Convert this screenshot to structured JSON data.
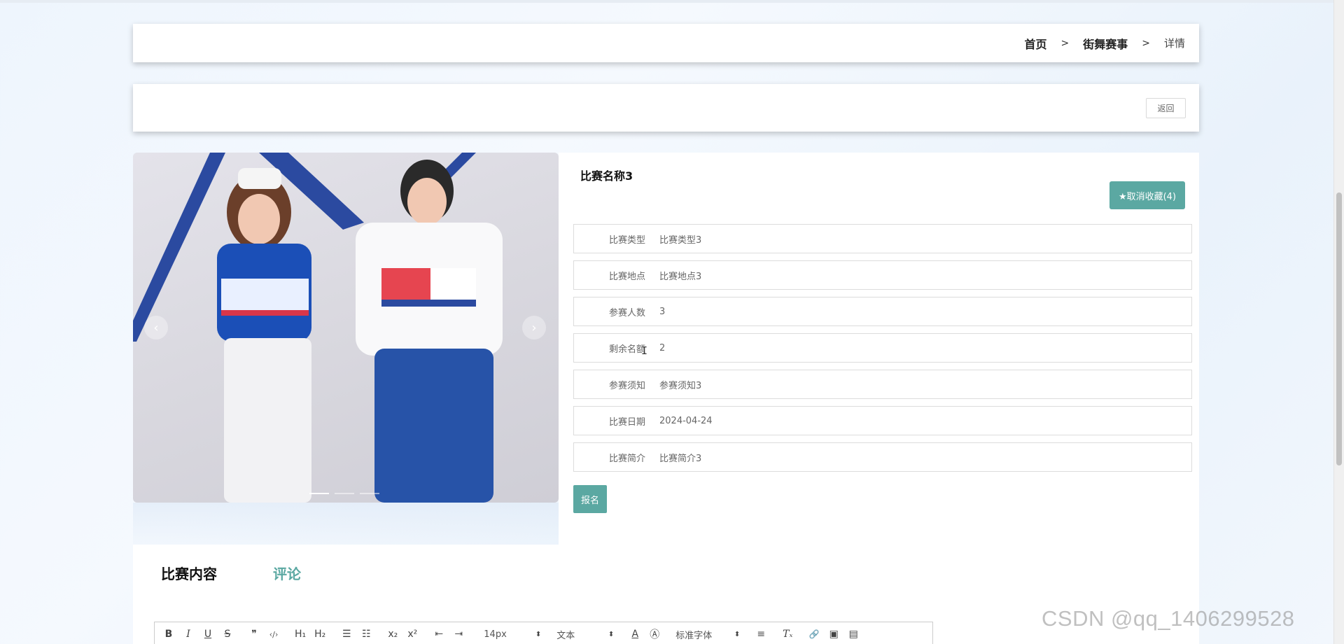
{
  "breadcrumb": {
    "home": "首页",
    "sep1": ">",
    "section": "街舞赛事",
    "sep2": ">",
    "current": "详情"
  },
  "back_button": "返回",
  "carousel": {
    "prev": "‹",
    "next": "›",
    "slide_count": 3,
    "active_slide": 1
  },
  "detail": {
    "title": "比赛名称3",
    "favorite_button": "★取消收藏(4)",
    "fields": [
      {
        "label": "比赛类型",
        "value": "比赛类型3"
      },
      {
        "label": "比赛地点",
        "value": "比赛地点3"
      },
      {
        "label": "参赛人数",
        "value": "3"
      },
      {
        "label": "剩余名额",
        "value": "2"
      },
      {
        "label": "参赛须知",
        "value": "参赛须知3"
      },
      {
        "label": "比赛日期",
        "value": "2024-04-24"
      },
      {
        "label": "比赛简介",
        "value": "比赛简介3"
      }
    ],
    "signup_button": "报名"
  },
  "tabs": {
    "content": "比赛内容",
    "comment": "评论"
  },
  "editor_toolbar": {
    "bold": "B",
    "italic": "I",
    "underline": "U",
    "strike": "S",
    "quote": "❞",
    "code": "‹/›",
    "h1": "H₁",
    "h2": "H₂",
    "ordered_list": "☰",
    "bullet_list": "☷",
    "subscript": "x₂",
    "superscript": "x²",
    "outdent": "⇤",
    "indent": "⇥",
    "size": "14px",
    "header": "文本",
    "font_color": "A",
    "background": "Ⓐ",
    "font": "标准字体",
    "align": "≡",
    "clean": "Tₓ",
    "link": "🔗",
    "image": "▣",
    "video": "▤"
  },
  "watermark": "CSDN @qq_1406299528",
  "colors": {
    "accent": "#5ba8a2",
    "panel": "#ffffff",
    "background": "#eef5fd"
  }
}
